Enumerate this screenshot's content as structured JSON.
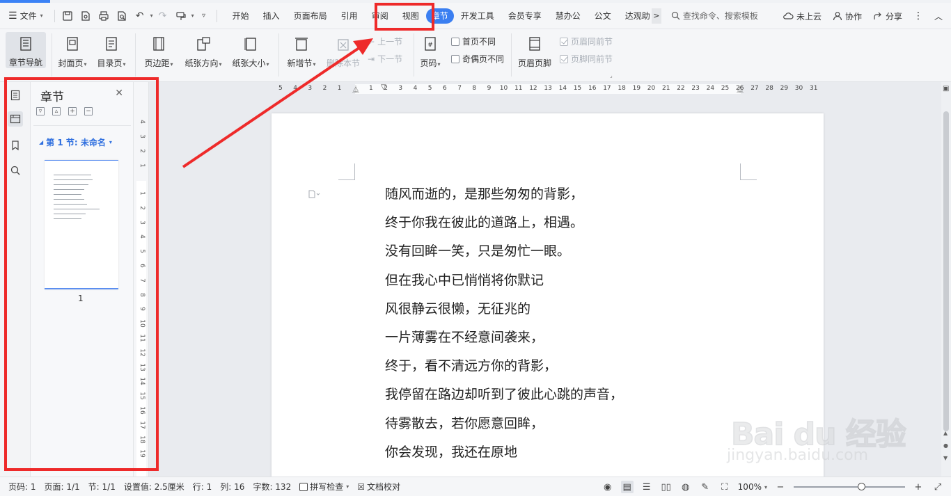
{
  "menubar": {
    "file_label": "文件",
    "tabs": [
      {
        "label": "开始",
        "active": false
      },
      {
        "label": "插入",
        "active": false
      },
      {
        "label": "页面布局",
        "active": false
      },
      {
        "label": "引用",
        "active": false
      },
      {
        "label": "审阅",
        "active": false
      },
      {
        "label": "视图",
        "active": false
      },
      {
        "label": "章节",
        "active": true
      },
      {
        "label": "开发工具",
        "active": false
      },
      {
        "label": "会员专享",
        "active": false
      },
      {
        "label": "慧办公",
        "active": false
      },
      {
        "label": "公文",
        "active": false
      },
      {
        "label": "达观助",
        "active": false
      }
    ],
    "more_glyph": ">",
    "search_placeholder": "查找命令、搜索模板",
    "cloud_label": "未上云",
    "collab_label": "协作",
    "share_label": "分享"
  },
  "ribbon": {
    "nav_label": "章节导航",
    "cover_label": "封面页",
    "toc_label": "目录页",
    "margin_label": "页边距",
    "orientation_label": "纸张方向",
    "size_label": "纸张大小",
    "new_section_label": "新增节",
    "delete_section_label": "删除本节",
    "prev_section_label": "上一节",
    "next_section_label": "下一节",
    "page_number_label": "页码",
    "first_page_diff_label": "首页不同",
    "odd_even_diff_label": "奇偶页不同",
    "header_footer_label": "页眉页脚",
    "header_same_label": "页眉同前节",
    "footer_same_label": "页脚同前节"
  },
  "chapter_panel": {
    "title": "章节",
    "section_label": "第 1 节: 未命名",
    "thumb_page_number": "1"
  },
  "ruler": {
    "h_numbers_left": [
      "5",
      "4",
      "3",
      "2",
      "1"
    ],
    "h_numbers_right": [
      "1",
      "2",
      "3",
      "4",
      "5",
      "6",
      "7",
      "8",
      "9",
      "10",
      "11",
      "12",
      "13",
      "14",
      "15",
      "16",
      "17",
      "18",
      "19",
      "20",
      "21",
      "22",
      "23",
      "24",
      "25",
      "26",
      "27",
      "28",
      "29",
      "30",
      "31"
    ],
    "v_numbers_top": [
      "4",
      "3",
      "2",
      "1"
    ],
    "v_numbers": [
      "1",
      "2",
      "3",
      "4",
      "5",
      "6",
      "7",
      "8",
      "9",
      "10",
      "11",
      "12",
      "13",
      "14",
      "15",
      "16",
      "17",
      "18",
      "19"
    ]
  },
  "document": {
    "lines": [
      "随风而逝的，是那些匆匆的背影，",
      "终于你我在彼此的道路上，相遇。",
      "没有回眸一笑，只是匆忙一眼。",
      "但在我心中已悄悄将你默记",
      "风很静云很懒，无征兆的",
      "一片薄雾在不经意间袭来，",
      "终于，看不清远方你的背影，",
      "我停留在路边却听到了彼此心跳的声音，",
      "待雾散去，若你愿意回眸，",
      "你会发现，我还在原地"
    ]
  },
  "statusbar": {
    "page_code": "页码: 1",
    "page": "页面: 1/1",
    "section": "节: 1/1",
    "setting": "设置值: 2.5厘米",
    "row": "行: 1",
    "col": "列: 16",
    "word_count": "字数: 132",
    "spell_check": "拼写检查",
    "doc_proof": "文档校对",
    "zoom": "100%"
  },
  "watermark": {
    "main": "Bai du 经验",
    "sub": "jingyan.baidu.com"
  },
  "colors": {
    "accent": "#3b7ff1",
    "highlight": "#ee2a2a",
    "section_blue": "#2f6fdf"
  }
}
